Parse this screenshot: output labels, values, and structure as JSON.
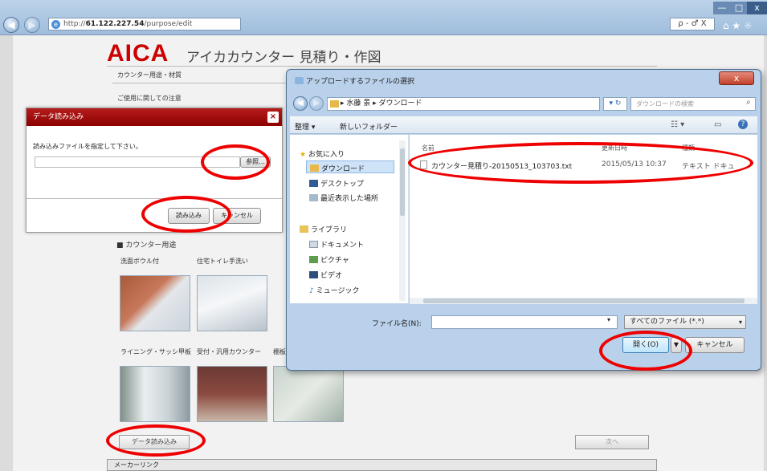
{
  "browser": {
    "url_prefix": "http://",
    "url_host": "61.122.227.54",
    "url_path": "/purpose/edit",
    "addr_controls": "ρ - ♂ X",
    "back_glyph": "◀",
    "forward_glyph": "▶",
    "min_glyph": "—",
    "max_glyph": "□",
    "close_glyph": "x",
    "toolbar_icons": "⌂ ★ ☼"
  },
  "page": {
    "logo": "AICA",
    "title": "アイカカウンター 見積り・作図",
    "menu_items": [
      "カウンター用途・材質",
      "ご使用に関しての注意"
    ],
    "section_title": "■ カウンター用途",
    "row1_labels": [
      "洗面ボウル付",
      "住宅トイレ手洗い"
    ],
    "row2_labels": [
      "ライニング・サッシ甲板",
      "受付・汎用カウンター",
      "棚板"
    ],
    "import_button": "データ読み込み",
    "next_button": "次へ",
    "footer": "メーカーリンク"
  },
  "import_dialog": {
    "title": "データ読み込み",
    "close": "×",
    "instruction": "読み込みファイルを指定して下さい。",
    "browse": "参照...",
    "load": "読み込み",
    "cancel": "キャンセル"
  },
  "file_dialog": {
    "title": "アップロードするファイルの選択",
    "breadcrumb": "▸ 水藤 景 ▸ ダウンロード",
    "search_placeholder": "ダウンロードの検索",
    "organize": "整理 ▾",
    "new_folder": "新しいフォルダー",
    "tree": {
      "favorites": "お気に入り",
      "downloads": "ダウンロード",
      "desktop": "デスクトップ",
      "recent": "最近表示した場所",
      "libraries": "ライブラリ",
      "documents": "ドキュメント",
      "pictures": "ピクチャ",
      "videos": "ビデオ",
      "music": "ミュージック"
    },
    "columns": [
      "名前",
      "更新日時",
      "種類"
    ],
    "file": {
      "name": "カウンター見積り-20150513_103703.txt",
      "date": "2015/05/13 10:37",
      "type": "テキスト ドキュ"
    },
    "filename_label": "ファイル名(N):",
    "filename_value": "",
    "filetype": "すべてのファイル (*.*)",
    "open": "開く(O)",
    "cancel": "キャンセル"
  },
  "colors": {
    "accent_red": "#e00000",
    "brand_red": "#cc0000"
  }
}
